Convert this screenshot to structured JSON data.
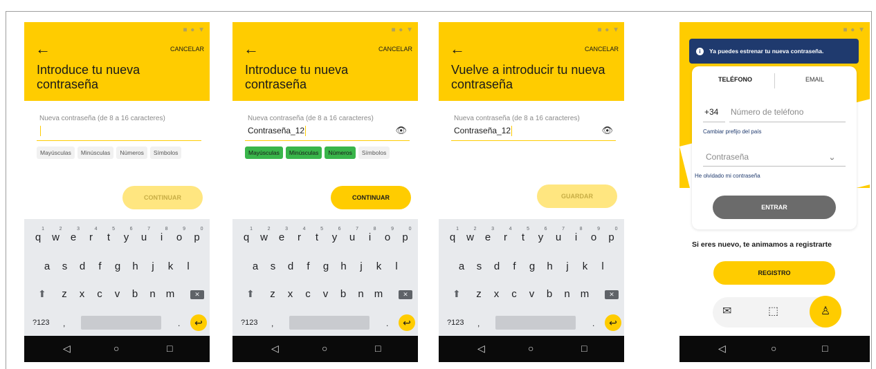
{
  "system_icons": "■ ● ▼",
  "icons": {
    "back": "←",
    "eye": "👁",
    "eye_closed": "ᴗ",
    "shift": "⬆",
    "backspace": "✕",
    "enter": "↩",
    "nav_back": "◁",
    "nav_home": "○",
    "nav_recent": "□",
    "info": "i",
    "postal": "✉",
    "package": "⬚",
    "user": "♙"
  },
  "colors": {
    "brand_yellow": "#ffcc00",
    "chip_green": "#39b54a",
    "toast_navy": "#1f3a6e"
  },
  "screen1": {
    "cancel": "CANCELAR",
    "title": "Introduce tu nueva contraseña",
    "field_label": "Nueva contraseña (de 8 a 16 caracteres)",
    "field_value": "",
    "chips": [
      "Mayúsculas",
      "Minúsculas",
      "Números",
      "Símbolos"
    ],
    "button": "CONTINUAR"
  },
  "screen2": {
    "cancel": "CANCELAR",
    "title": "Introduce tu nueva contraseña",
    "field_label": "Nueva contraseña (de 8 a 16 caracteres)",
    "field_value": "Contraseña_12",
    "chips": [
      "Mayúsculas",
      "Minúsculas",
      "Números",
      "Símbolos"
    ],
    "button": "CONTINUAR"
  },
  "screen3": {
    "cancel": "CANCELAR",
    "title": "Vuelve a introducir tu nueva contraseña",
    "field_label": "Nueva contraseña (de 8 a 16 caracteres)",
    "field_value": "Contraseña_12",
    "button": "GUARDAR"
  },
  "keyboard": {
    "row1": [
      "q",
      "w",
      "e",
      "r",
      "t",
      "y",
      "u",
      "i",
      "o",
      "p"
    ],
    "row1_hints": [
      "1",
      "2",
      "3",
      "4",
      "5",
      "6",
      "7",
      "8",
      "9",
      "0"
    ],
    "row2": [
      "a",
      "s",
      "d",
      "f",
      "g",
      "h",
      "j",
      "k",
      "l"
    ],
    "row3": [
      "z",
      "x",
      "c",
      "v",
      "b",
      "n",
      "m"
    ],
    "symbols": "?123",
    "comma": ",",
    "dot": "."
  },
  "screen4": {
    "toast": "Ya puedes estrenar tu nueva contraseña.",
    "tab_phone": "TELÉFONO",
    "tab_email": "EMAIL",
    "prefix": "+34",
    "phone_placeholder": "Número de teléfono",
    "change_prefix": "Cambiar prefijo del país",
    "password_placeholder": "Contraseña",
    "forgot": "He olvidado mi contraseña",
    "login_button": "ENTRAR",
    "register_text": "Si eres nuevo, te animamos a registrarte",
    "register_button": "REGISTRO"
  }
}
